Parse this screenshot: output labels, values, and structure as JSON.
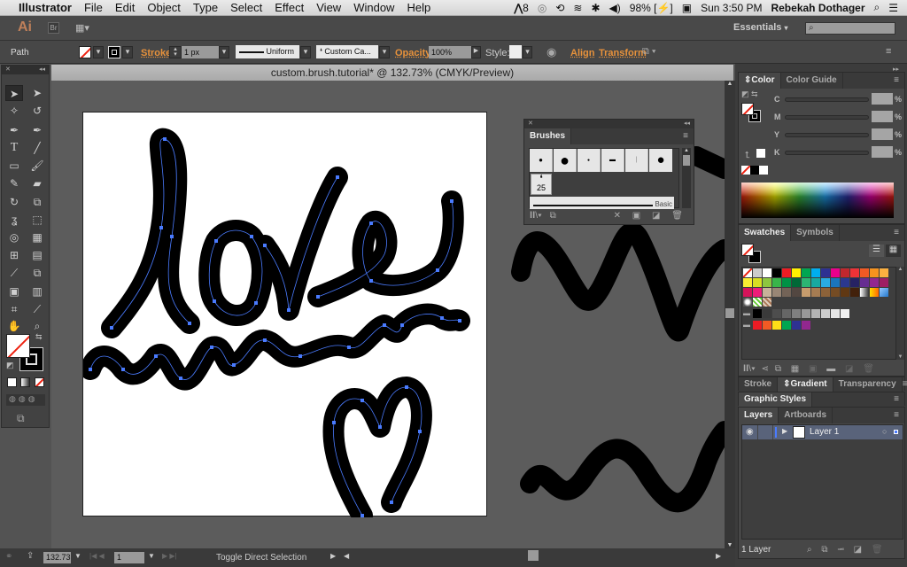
{
  "menubar": {
    "apple": "",
    "app_name": "Illustrator",
    "items": [
      "File",
      "Edit",
      "Object",
      "Type",
      "Select",
      "Effect",
      "View",
      "Window",
      "Help"
    ],
    "adobe_badge": "8",
    "battery": "98%",
    "clock": "Sun 3:50 PM",
    "user": "Rebekah Dothager"
  },
  "appbar": {
    "logo": "Ai",
    "bridge": "Br",
    "workspace": "Essentials",
    "search_placeholder": ""
  },
  "controlbar": {
    "selection_type": "Path",
    "stroke_label": "Stroke:",
    "stroke_weight": "1 px",
    "profile": "Uniform",
    "brush": "Custom Ca...",
    "opacity_label": "Opacity:",
    "opacity": "100%",
    "style_label": "Style:",
    "align": "Align",
    "transform": "Transform"
  },
  "document": {
    "title": "custom.brush.tutorial* @ 132.73% (CMYK/Preview)",
    "path_color": "#4a7bff"
  },
  "brushes_panel": {
    "title": "Brushes",
    "selected_brush_size": "25",
    "basic_label": "Basic"
  },
  "color_panel": {
    "tabs": [
      "Color",
      "Color Guide"
    ],
    "channels": [
      "C",
      "M",
      "Y",
      "K"
    ],
    "unit": "%"
  },
  "swatches_panel": {
    "tabs": [
      "Swatches",
      "Symbols"
    ],
    "rows": [
      [
        "none",
        "reg",
        "#ffffff",
        "#000000",
        "#ed1c24",
        "#fff200",
        "#00a651",
        "#00aeef",
        "#2e3192",
        "#ec008c",
        "#c1272d",
        "#ed3237",
        "#f15a24",
        "#f7931e",
        "#fbb040"
      ],
      [
        "#f9ed32",
        "#d7df23",
        "#8dc63f",
        "#39b54a",
        "#009245",
        "#006837",
        "#2bb673",
        "#17a9a0",
        "#29abe2",
        "#1b75bc",
        "#2b388f",
        "#262262",
        "#662d91",
        "#92278f",
        "#9e1f63"
      ],
      [
        "#d4145a",
        "#ed1e79",
        "#c7b299",
        "#998675",
        "#736357",
        "#534741",
        "#c69c6d",
        "#a67c52",
        "#8c6239",
        "#754c24",
        "#603813",
        "#42210b",
        "grad1",
        "grad2",
        "grad3"
      ]
    ],
    "pattern_row": [
      "pat1",
      "pat2",
      "pat3"
    ],
    "gray_group": [
      "#000000",
      "#3a3a3a",
      "#4d4d4d",
      "#666666",
      "#808080",
      "#999999",
      "#b3b3b3",
      "#cccccc",
      "#e6e6e6",
      "#f2f2f2"
    ],
    "color_group": [
      "#ed1c24",
      "#f15a24",
      "#ffde17",
      "#00a651",
      "#2e3192",
      "#92278f"
    ]
  },
  "lower_panels": {
    "tabs1": [
      "Stroke",
      "Gradient",
      "Transparency"
    ],
    "graphic_styles": "Graphic Styles",
    "tabs2": [
      "Layers",
      "Artboards"
    ],
    "layer_name": "Layer 1",
    "layer_count": "1 Layer"
  },
  "statusbar": {
    "zoom": "132.73",
    "artboard": "1",
    "status_text": "Toggle Direct Selection"
  }
}
